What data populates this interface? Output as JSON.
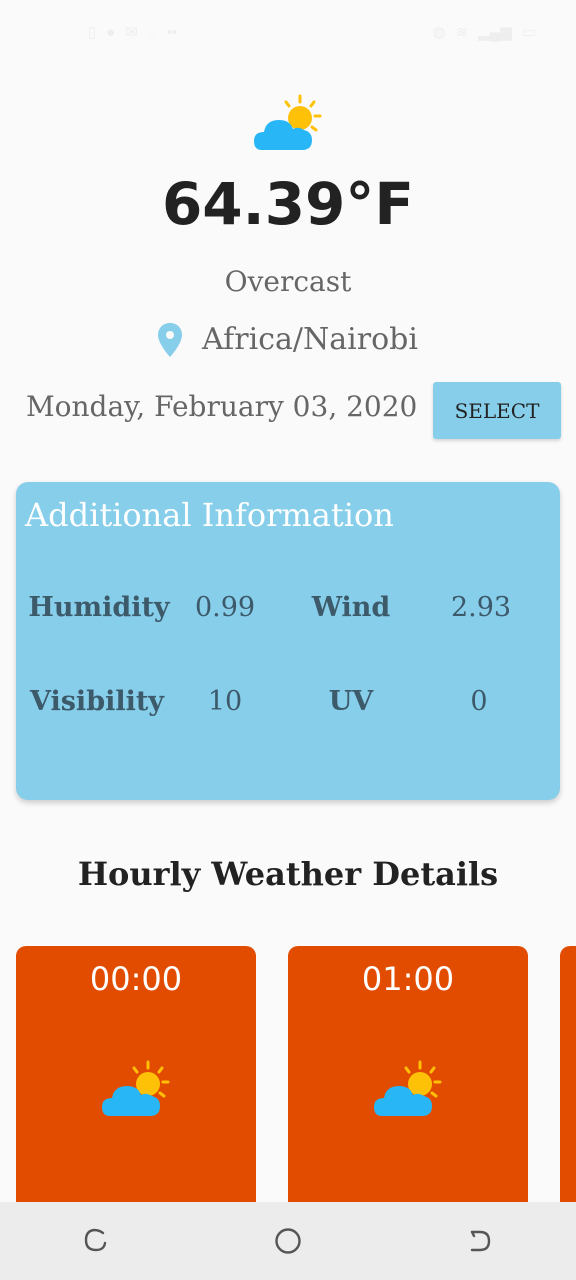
{
  "status_bar": {
    "left_icons": [
      "sim-icon",
      "notification-icon",
      "mail-icon",
      "whatsapp-icon",
      "more-icon"
    ],
    "right_icons": [
      "alarm-icon",
      "wifi-icon",
      "signal-icon",
      "battery-icon"
    ]
  },
  "current": {
    "icon": "partly-cloudy-icon",
    "temperature": "64.39°F",
    "condition": "Overcast",
    "location": "Africa/Nairobi"
  },
  "date": {
    "text": "Monday, February 03, 2020",
    "select_label": "SELECT"
  },
  "additional_info": {
    "title": "Additional Information",
    "humidity_label": "Humidity",
    "humidity_value": "0.99",
    "wind_label": "Wind",
    "wind_value": "2.93",
    "visibility_label": "Visibility",
    "visibility_value": "10",
    "uv_label": "UV",
    "uv_value": "0"
  },
  "hourly": {
    "title": "Hourly Weather Details",
    "items": [
      {
        "time": "00:00",
        "icon": "partly-cloudy-icon"
      },
      {
        "time": "01:00",
        "icon": "partly-cloudy-icon"
      }
    ]
  },
  "colors": {
    "accent": "#87ceeb",
    "hour_card": "#e24c00",
    "cloud": "#29b6f6",
    "sun": "#ffc107"
  }
}
